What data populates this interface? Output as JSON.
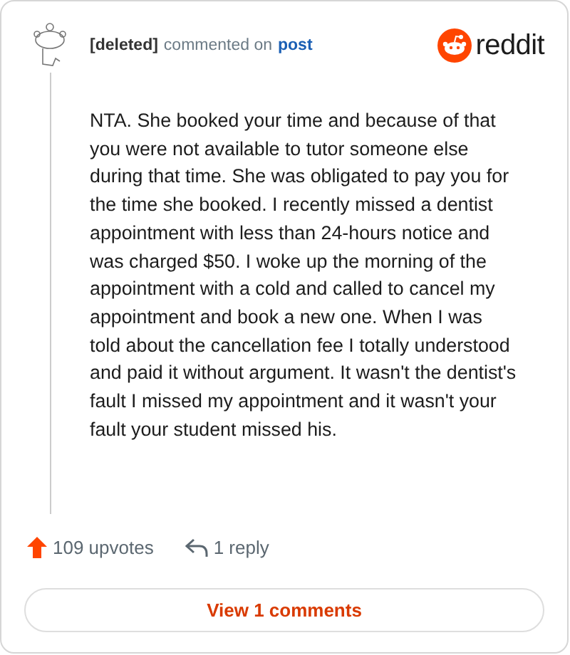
{
  "header": {
    "author": "[deleted]",
    "action": "commented on",
    "link": "post",
    "brand": "reddit"
  },
  "comment": {
    "body": "NTA. She booked your time and because of that you were not available to tutor someone else during that time. She was obligated to pay you for the time she booked. I recently missed a dentist appointment with less than 24-hours notice and was charged $50. I woke up the morning of the appointment with a cold and called to cancel my appointment and book a new one. When I was told about the cancellation fee I totally understood and paid it without argument. It wasn't the dentist's fault I missed my appointment and it wasn't your fault your student missed his."
  },
  "footer": {
    "upvotes": "109 upvotes",
    "replies": "1 reply",
    "button": "View 1 comments"
  }
}
